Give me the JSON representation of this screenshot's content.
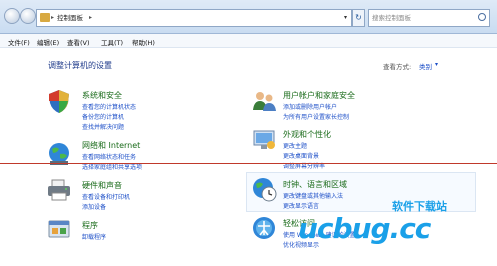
{
  "address_bar": {
    "crumb": "控制面板",
    "search_placeholder": "搜索控制面板"
  },
  "menu": [
    "文件(F)",
    "编辑(E)",
    "查看(V)",
    "工具(T)",
    "帮助(H)"
  ],
  "page": {
    "title": "调整计算机的设置",
    "view_by_label": "查看方式:",
    "view_by_value": "类别"
  },
  "categories": [
    {
      "title": "系统和安全",
      "links": [
        "查看您的计算机状态",
        "备份您的计算机",
        "查找并解决问题"
      ]
    },
    {
      "title": "网络和 Internet",
      "links": [
        "查看网络状态和任务",
        "选择家庭组和共享选项"
      ]
    },
    {
      "title": "硬件和声音",
      "links": [
        "查看设备和打印机",
        "添加设备"
      ]
    },
    {
      "title": "程序",
      "links": [
        "卸载程序"
      ]
    },
    {
      "title": "用户帐户和家庭安全",
      "links": [
        "添加或删除用户帐户",
        "为所有用户设置家长控制"
      ]
    },
    {
      "title": "外观和个性化",
      "links": [
        "更改主题",
        "更改桌面背景",
        "调整屏幕分辨率"
      ]
    },
    {
      "title": "时钟、语言和区域",
      "links": [
        "更改键盘或其他输入法",
        "更改显示语言"
      ]
    },
    {
      "title": "轻松访问",
      "links": [
        "使用 Windows 建议的设置",
        "优化视频显示"
      ]
    }
  ],
  "watermark": {
    "logo": "ucbug.cc",
    "text": "软件下载站"
  }
}
